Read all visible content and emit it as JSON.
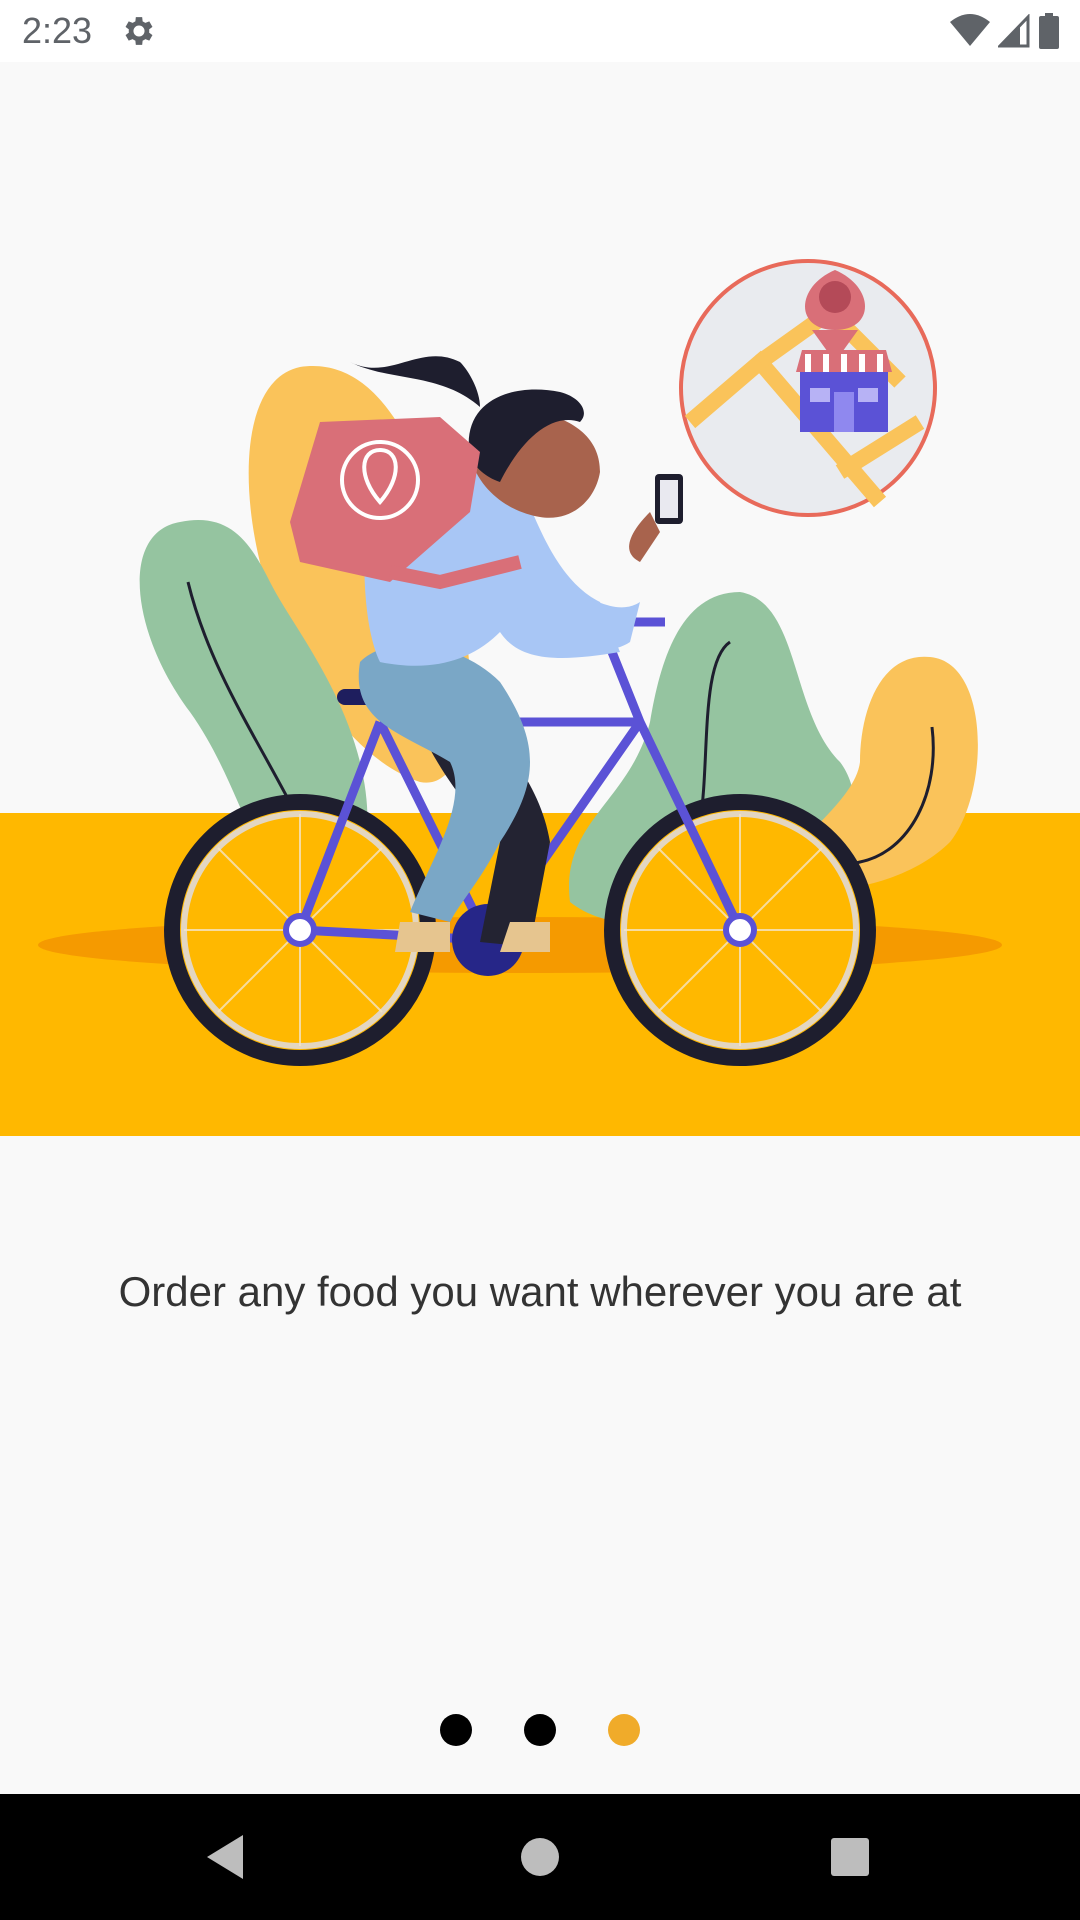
{
  "status_bar": {
    "time": "2:23",
    "icons": [
      "gear-icon",
      "wifi-icon",
      "cellular-signal-icon",
      "battery-icon"
    ]
  },
  "illustration": {
    "description_icon": "delivery-cyclist-illustration",
    "colors": {
      "ground": "#ffb800",
      "shadow": "#f59a00",
      "leaf_green": "#95c4a0",
      "leaf_yellow": "#fac35a",
      "bike": "#5b52d6",
      "bag": "#d96f78",
      "map_circle_border": "#e86a5a"
    }
  },
  "onboarding": {
    "message": "Order any food you want wherever you are at",
    "pages": 3,
    "current_page": 3
  },
  "indicator": {
    "inactive_color": "#000000",
    "active_color": "#f0ab2a"
  },
  "nav_bar": {
    "buttons": [
      "back-icon",
      "home-icon",
      "recents-icon"
    ]
  }
}
